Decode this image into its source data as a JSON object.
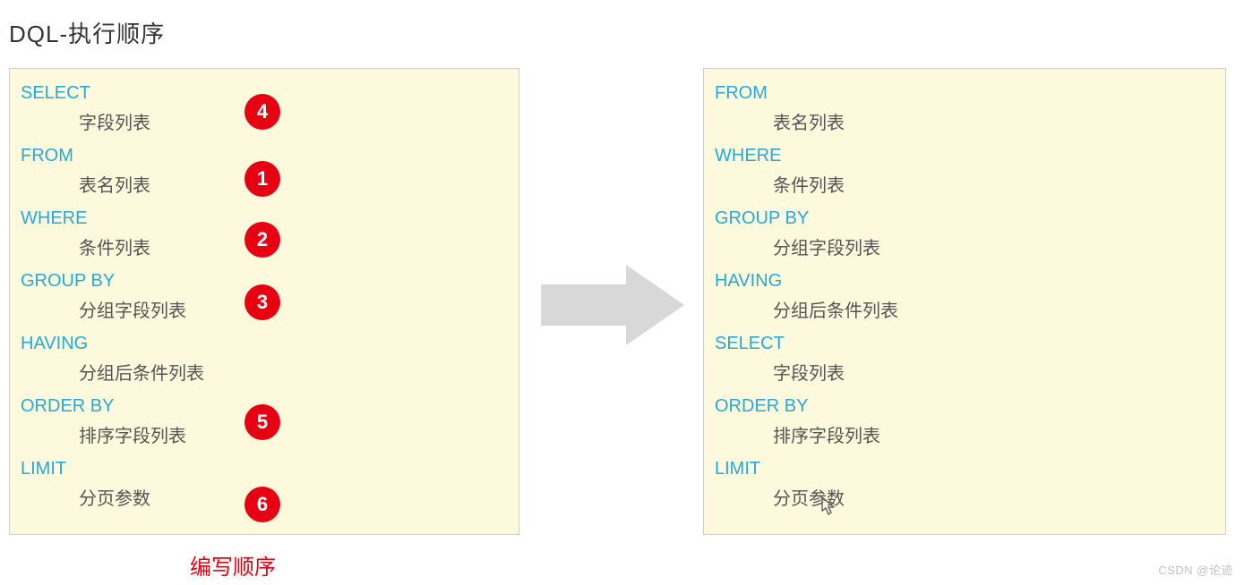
{
  "title": "DQL-执行顺序",
  "left_caption": "编写顺序",
  "watermark": "CSDN @论迹",
  "left_panel": {
    "items": [
      {
        "keyword": "SELECT",
        "desc": "字段列表",
        "badge": "4"
      },
      {
        "keyword": "FROM",
        "desc": "表名列表",
        "badge": "1"
      },
      {
        "keyword": "WHERE",
        "desc": "条件列表",
        "badge": "2"
      },
      {
        "keyword": "GROUP  BY",
        "desc": "分组字段列表",
        "badge": "3"
      },
      {
        "keyword": "HAVING",
        "desc": "分组后条件列表",
        "badge": ""
      },
      {
        "keyword": "ORDER BY",
        "desc": "排序字段列表",
        "badge": "5"
      },
      {
        "keyword": "LIMIT",
        "desc": "分页参数",
        "badge": "6"
      }
    ]
  },
  "right_panel": {
    "items": [
      {
        "keyword": "FROM",
        "desc": "表名列表"
      },
      {
        "keyword": "WHERE",
        "desc": "条件列表"
      },
      {
        "keyword": "GROUP  BY",
        "desc": "分组字段列表"
      },
      {
        "keyword": "HAVING",
        "desc": "分组后条件列表"
      },
      {
        "keyword": " SELECT",
        "desc": "字段列表"
      },
      {
        "keyword": "ORDER BY",
        "desc": "排序字段列表"
      },
      {
        "keyword": "LIMIT",
        "desc": "分页参数"
      }
    ]
  },
  "badge_positions": [
    105,
    180,
    248,
    318,
    452,
    544
  ]
}
